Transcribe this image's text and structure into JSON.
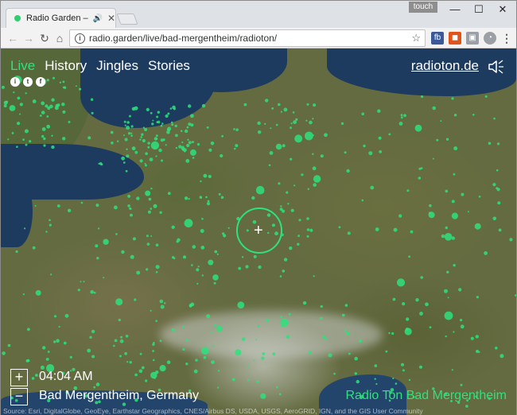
{
  "browser": {
    "tab_title": "Radio Garden – Radi",
    "tab_audio_icon": "speaker-icon",
    "user_badge": "touch",
    "url": "radio.garden/live/bad-mergentheim/radioton/",
    "extensions": [
      "fb",
      "office",
      "screenshot",
      "timer"
    ]
  },
  "nav": {
    "items": [
      "Live",
      "History",
      "Jingles",
      "Stories"
    ],
    "active": "Live"
  },
  "header": {
    "site_link": "radioton.de"
  },
  "player": {
    "time": "04:04 AM",
    "place": "Bad Mergentheim, Germany",
    "station": "Radio Ton Bad Mergentheim"
  },
  "attribution": "Source: Esri, DigitalGlobe, GeoEye, Earthstar Geographics, CNES/Airbus DS, USDA, USGS, AeroGRID, IGN, and the GIS User Community",
  "colors": {
    "accent": "#2de27c",
    "tab_dot": "#2ecf6f"
  }
}
